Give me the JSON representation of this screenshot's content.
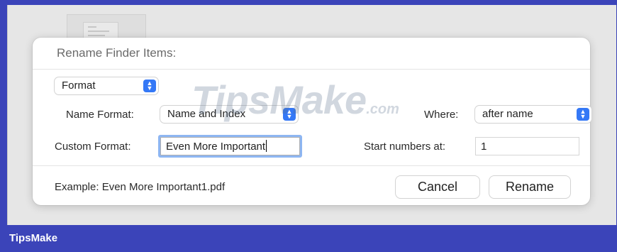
{
  "dialog": {
    "title": "Rename Finder Items:",
    "mode_select": "Format",
    "name_format_label": "Name Format:",
    "name_format_value": "Name and Index",
    "where_label": "Where:",
    "where_value": "after name",
    "custom_format_label": "Custom Format:",
    "custom_format_value": "Even More Important",
    "start_numbers_label": "Start numbers at:",
    "start_numbers_value": "1",
    "example_text": "Example: Even More Important1.pdf",
    "cancel_label": "Cancel",
    "rename_label": "Rename"
  },
  "watermark": {
    "text": "TipsMake",
    "suffix": ".com"
  },
  "footer": {
    "brand": "TipsMake"
  },
  "colors": {
    "accent": "#3478f6",
    "focus_ring": "#8eb6f2",
    "frame": "#3b44b9"
  },
  "icons": {
    "popup_stepper": "chevron-up-down-icon"
  }
}
